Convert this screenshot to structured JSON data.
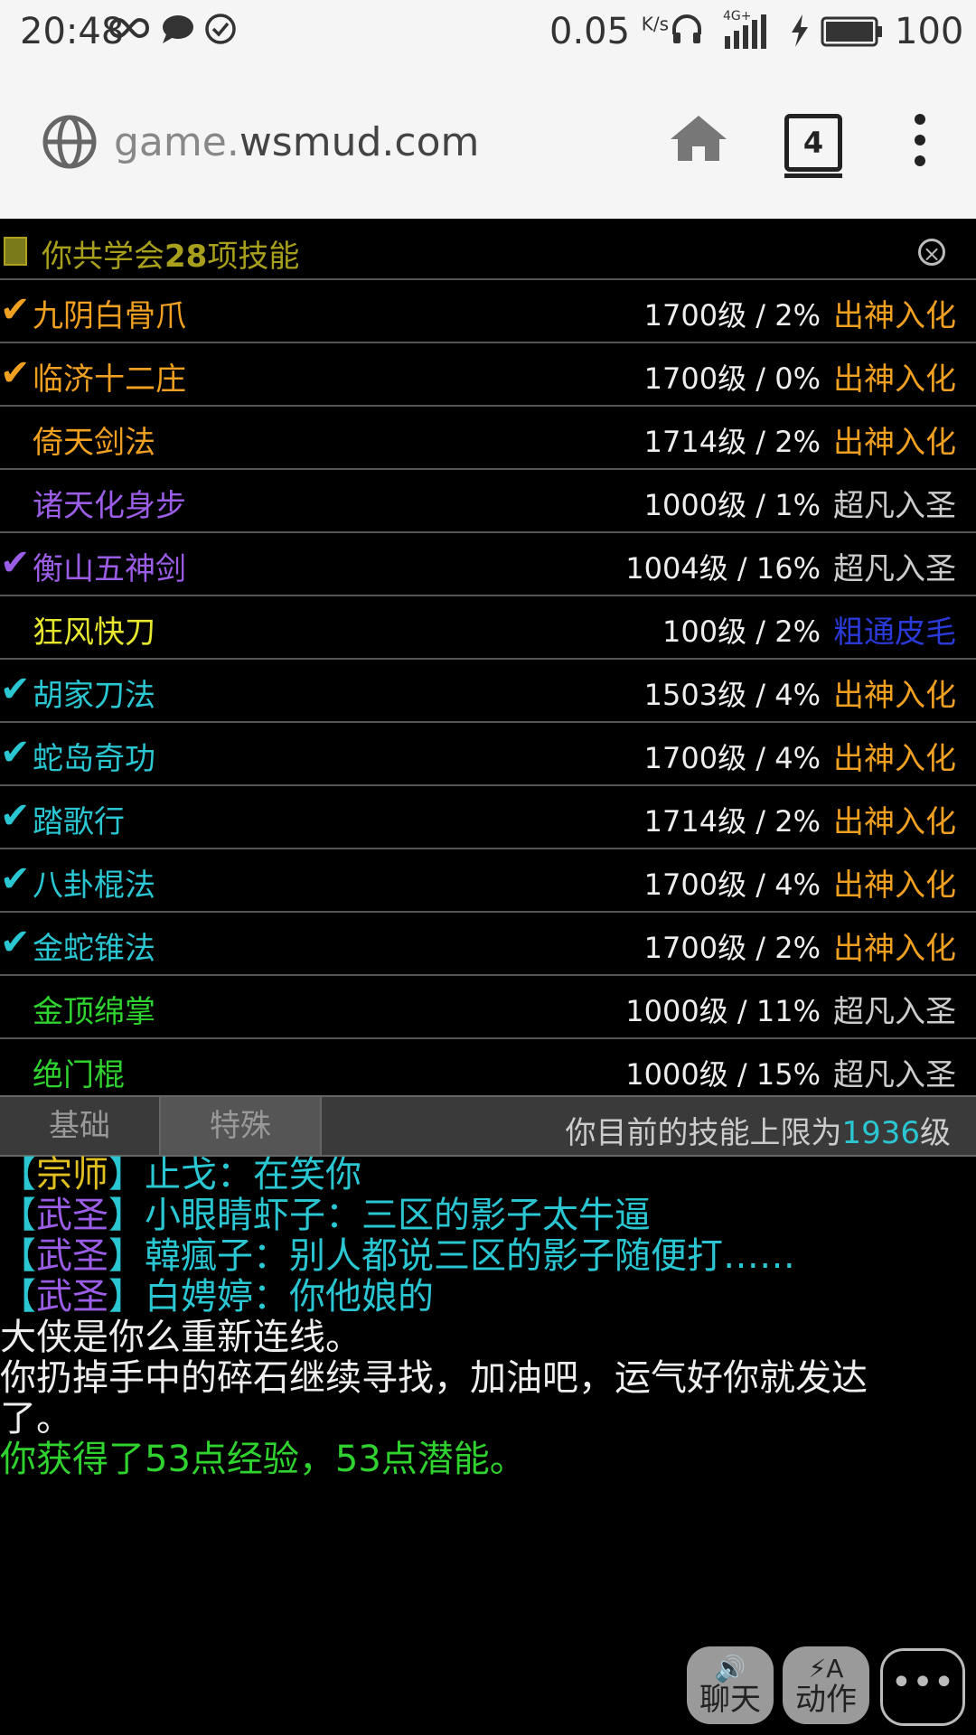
{
  "status_bar": {
    "time": "20:48",
    "speed_value": "0.05",
    "speed_unit": "K/s",
    "network": "4G+",
    "battery": "100"
  },
  "browser": {
    "url_prefix": "game.",
    "url_domain": "wsmud.com",
    "tab_count": "4"
  },
  "skills_panel": {
    "title_prefix": "你共学会",
    "count": "28",
    "title_suffix": "项技能",
    "skills": [
      {
        "check": "✔",
        "check_color": "#f0a020",
        "name": "九阴白骨爪",
        "name_color": "#f0a020",
        "level": "1700级 / 2%",
        "rank": "出神入化",
        "rank_color": "#f0a020"
      },
      {
        "check": "✔",
        "check_color": "#f0a020",
        "name": "临济十二庄",
        "name_color": "#f0a020",
        "level": "1700级 / 0%",
        "rank": "出神入化",
        "rank_color": "#f0a020"
      },
      {
        "check": "",
        "check_color": "#f0a020",
        "name": "倚天剑法",
        "name_color": "#f0a020",
        "level": "1714级 / 2%",
        "rank": "出神入化",
        "rank_color": "#f0a020"
      },
      {
        "check": "",
        "check_color": "#9b5de5",
        "name": "诸天化身步",
        "name_color": "#9b5de5",
        "level": "1000级 / 1%",
        "rank": "超凡入圣",
        "rank_color": "#cccccc"
      },
      {
        "check": "✔",
        "check_color": "#9b5de5",
        "name": "衡山五神剑",
        "name_color": "#9b5de5",
        "level": "1004级 / 16%",
        "rank": "超凡入圣",
        "rank_color": "#cccccc"
      },
      {
        "check": "",
        "check_color": "#e6e62e",
        "name": "狂风快刀",
        "name_color": "#e6e62e",
        "level": "100级 / 2%",
        "rank": "粗通皮毛",
        "rank_color": "#2a3ad8"
      },
      {
        "check": "✔",
        "check_color": "#2ac6d2",
        "name": "胡家刀法",
        "name_color": "#2ac6d2",
        "level": "1503级 / 4%",
        "rank": "出神入化",
        "rank_color": "#f0a020"
      },
      {
        "check": "✔",
        "check_color": "#2ac6d2",
        "name": "蛇岛奇功",
        "name_color": "#2ac6d2",
        "level": "1700级 / 4%",
        "rank": "出神入化",
        "rank_color": "#f0a020"
      },
      {
        "check": "✔",
        "check_color": "#2ac6d2",
        "name": "踏歌行",
        "name_color": "#2ac6d2",
        "level": "1714级 / 2%",
        "rank": "出神入化",
        "rank_color": "#f0a020"
      },
      {
        "check": "✔",
        "check_color": "#2ac6d2",
        "name": "八卦棍法",
        "name_color": "#2ac6d2",
        "level": "1700级 / 4%",
        "rank": "出神入化",
        "rank_color": "#f0a020"
      },
      {
        "check": "✔",
        "check_color": "#2ac6d2",
        "name": "金蛇锥法",
        "name_color": "#2ac6d2",
        "level": "1700级 / 2%",
        "rank": "出神入化",
        "rank_color": "#f0a020"
      },
      {
        "check": "",
        "check_color": "#2fd22f",
        "name": "金顶绵掌",
        "name_color": "#2fd22f",
        "level": "1000级 / 11%",
        "rank": "超凡入圣",
        "rank_color": "#cccccc"
      },
      {
        "check": "",
        "check_color": "#2fd22f",
        "name": "绝门棍",
        "name_color": "#2fd22f",
        "level": "1000级 / 15%",
        "rank": "超凡入圣",
        "rank_color": "#cccccc"
      }
    ]
  },
  "tabs": {
    "basic": "基础",
    "special": "特殊",
    "limit_prefix": "你目前的技能上限为",
    "limit_value": "1936",
    "limit_suffix": "级"
  },
  "chat": {
    "messages": [
      {
        "open": "【",
        "title": "宗师",
        "close": "】",
        "title_color": "#e0c020",
        "text": "止戈：在笑你"
      },
      {
        "open": "【",
        "title": "武圣",
        "close": "】",
        "title_color": "#9b5de5",
        "text": "小眼睛虾子：三区的影子太牛逼"
      },
      {
        "open": "【",
        "title": "武圣",
        "close": "】",
        "title_color": "#9b5de5",
        "text": "韓瘋子：别人都说三区的影子随便打……"
      },
      {
        "open": "【",
        "title": "武圣",
        "close": "】",
        "title_color": "#9b5de5",
        "text": "白娉婷：你他娘的"
      }
    ],
    "system_1": "大侠是你么重新连线。",
    "system_2a": "你扔掉手中的碎石继续寻找，加油吧，运气好你就发达",
    "system_2b": "了。",
    "reward": "你获得了53点经验，53点潜能。"
  },
  "buttons": {
    "chat_label": "聊天",
    "action_icon_letter": "A",
    "action_label": "动作",
    "more_label": "•••"
  }
}
